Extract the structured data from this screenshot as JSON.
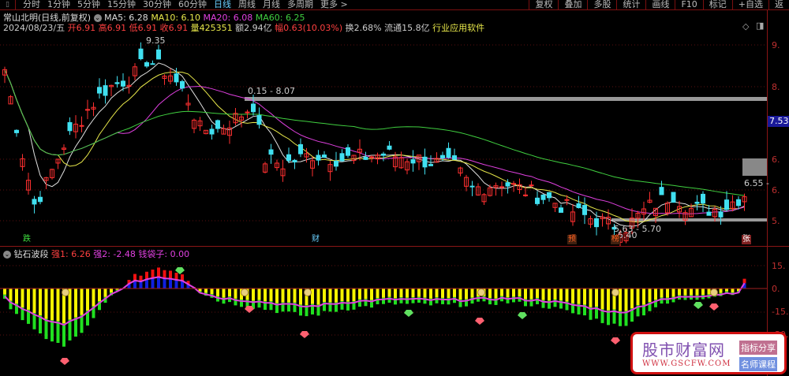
{
  "toolbar": {
    "tabs": [
      "分时",
      "1分钟",
      "5分钟",
      "15分钟",
      "30分钟",
      "60分钟",
      "日线",
      "周线",
      "月线",
      "多周期",
      "更多 >"
    ],
    "active_tab": "日线",
    "right_buttons": [
      "复权",
      "叠加",
      "多股",
      "统计",
      "画线",
      "F10",
      "标记",
      "+自选",
      "返"
    ]
  },
  "header": {
    "stock_title": "常山北明(日线,前复权)",
    "ma5": "MA5: 6.28",
    "ma10": "MA10: 6.10",
    "ma20": "MA20: 6.08",
    "ma60": "MA60: 6.25",
    "date": "2024/08/23/五",
    "open": "开6.91",
    "high": "高6.91",
    "low": "低6.91",
    "close": "收6.91",
    "volume": "量425351",
    "amount": "额2.94亿",
    "change": "幅0.63(10.03%)",
    "turnover": "换2.68%",
    "float": "流通15.8亿",
    "industry": "行业应用软件"
  },
  "price_axis": {
    "labels": [
      "9.",
      "8.",
      "6.",
      "6.",
      "5."
    ],
    "current_price": "7.53"
  },
  "annotations": {
    "high": "9.35",
    "range1": "0.15 - 8.07",
    "range2": "5.63 - 5.70",
    "low": "5.40",
    "right_level": "6.55 -"
  },
  "markers": [
    "跌",
    "财",
    "预",
    "榜",
    "张"
  ],
  "sub_indicator": {
    "name": "钻石波段",
    "qiang1": "强1: 6.26",
    "qiang2": "强2: -2.48",
    "qiandaizi": "钱袋子: 0.00",
    "axis_labels": [
      "15.",
      "0.",
      "-15.",
      "-30."
    ]
  },
  "watermark": {
    "title": "股市财富网",
    "url": "WWW.GSCFW.COM",
    "tag1": "指标分享",
    "tag2": "名师课程"
  },
  "colors": {
    "up": "#ff3030",
    "down": "#40e0f0",
    "ma5": "#e0e0e0",
    "ma10": "#e8e84a",
    "ma20": "#e040e0",
    "ma60": "#40d040"
  },
  "price_series": {
    "anchors": [
      [
        0,
        8.7
      ],
      [
        3,
        7.0
      ],
      [
        5,
        6.0
      ],
      [
        7,
        6.4
      ],
      [
        10,
        7.2
      ],
      [
        14,
        7.9
      ],
      [
        17,
        8.3
      ],
      [
        22,
        8.6
      ],
      [
        24,
        8.9
      ],
      [
        28,
        8.6
      ],
      [
        31,
        8.1
      ],
      [
        33,
        7.5
      ],
      [
        36,
        7.5
      ],
      [
        40,
        7.8
      ],
      [
        42,
        8.0
      ],
      [
        44,
        6.9
      ],
      [
        47,
        6.8
      ],
      [
        52,
        7.0
      ],
      [
        57,
        6.9
      ],
      [
        64,
        7.0
      ],
      [
        70,
        6.9
      ],
      [
        76,
        6.75
      ],
      [
        79,
        6.3
      ],
      [
        84,
        6.45
      ],
      [
        86,
        6.35
      ],
      [
        92,
        6.1
      ],
      [
        97,
        5.8
      ],
      [
        102,
        5.6
      ],
      [
        105,
        5.55
      ],
      [
        109,
        5.95
      ],
      [
        113,
        6.2
      ],
      [
        116,
        5.9
      ],
      [
        121,
        5.9
      ],
      [
        125,
        6.2
      ]
    ]
  },
  "sub_series": {
    "anchors": [
      [
        0,
        -8
      ],
      [
        5,
        -28
      ],
      [
        10,
        -38
      ],
      [
        14,
        -25
      ],
      [
        18,
        -5
      ],
      [
        22,
        8
      ],
      [
        26,
        14
      ],
      [
        30,
        10
      ],
      [
        33,
        -2
      ],
      [
        36,
        -8
      ],
      [
        42,
        -12
      ],
      [
        51,
        -18
      ],
      [
        58,
        -13
      ],
      [
        66,
        -10
      ],
      [
        75,
        -11
      ],
      [
        85,
        -9
      ],
      [
        92,
        -12
      ],
      [
        98,
        -18
      ],
      [
        104,
        -25
      ],
      [
        110,
        -12
      ],
      [
        115,
        -7
      ],
      [
        120,
        -5
      ],
      [
        124,
        -2
      ],
      [
        125,
        5
      ]
    ]
  }
}
